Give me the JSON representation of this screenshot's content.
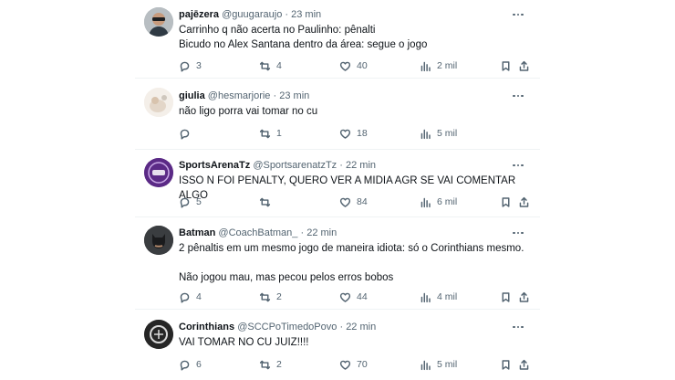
{
  "tweets": [
    {
      "name": "pajēzera",
      "handle": "@guugaraujo",
      "separator": "·",
      "time": "23 min",
      "text": "Carrinho q não acerta no Paulinho: pênalti\nBicudo no Alex Santana dentro da área: segue o jogo",
      "avatar_icon": "sunglasses-man-avatar",
      "replies": "3",
      "retweets": "4",
      "likes": "40",
      "views": "2 mil"
    },
    {
      "name": "giulia",
      "handle": "@hesmarjorie",
      "separator": "·",
      "time": "23 min",
      "text": "não ligo porra vai tomar no cu",
      "avatar_icon": "light-photo-avatar",
      "replies": "",
      "retweets": "1",
      "likes": "18",
      "views": "5 mil"
    },
    {
      "name": "SportsArenaTz",
      "handle": "@SportsarenatzTz",
      "separator": "·",
      "time": "22 min",
      "text": "ISSO N FOI PENALTY, QUERO VER A MIDIA AGR SE VAI COMENTAR ALGO",
      "avatar_icon": "purple-logo-avatar",
      "replies": "5",
      "retweets": "",
      "likes": "84",
      "views": "6 mil"
    },
    {
      "name": "Batman",
      "handle": "@CoachBatman_",
      "separator": "·",
      "time": "22 min",
      "text": "2 pênaltis em um mesmo jogo de maneira idiota: só o Corinthians mesmo.\n\nNão jogou mau, mas pecou pelos erros bobos",
      "avatar_icon": "batman-avatar",
      "replies": "4",
      "retweets": "2",
      "likes": "44",
      "views": "4 mil"
    },
    {
      "name": "Corinthians",
      "handle": "@SCCPoTimedoPovo",
      "separator": "·",
      "time": "22 min",
      "text": "VAI TOMAR NO CU JUIZ!!!!",
      "avatar_icon": "crest-avatar",
      "replies": "6",
      "retweets": "2",
      "likes": "70",
      "views": "5 mil"
    }
  ],
  "icons": {
    "reply": "reply-icon",
    "retweet": "retweet-icon",
    "like": "heart-icon",
    "views": "views-chart-icon",
    "bookmark": "bookmark-icon",
    "share": "share-icon",
    "more": "more-options-icon"
  },
  "colors": {
    "text": "#0f1419",
    "secondary": "#536471",
    "divider": "#eff3f4",
    "sports_arena_avatar": "#5b2a86"
  }
}
